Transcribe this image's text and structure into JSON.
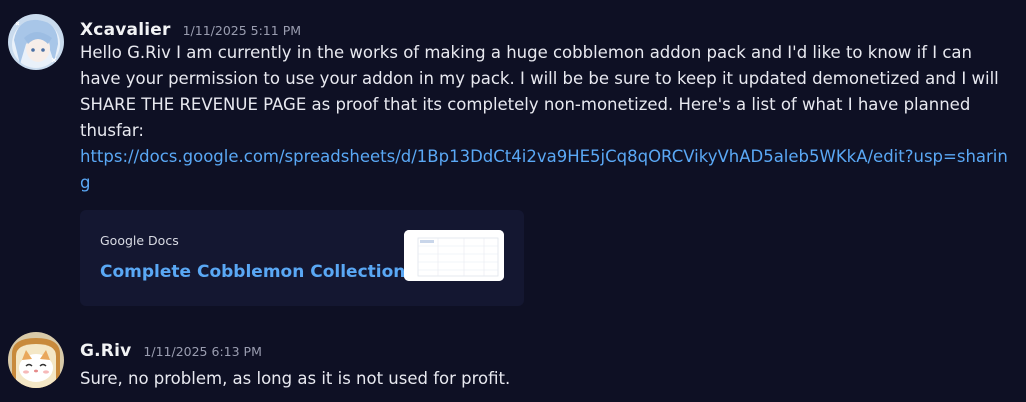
{
  "messages": [
    {
      "username": "Xcavalier",
      "timestamp": "1/11/2025 5:11 PM",
      "text": "Hello G.Riv I am currently in the works of making a huge cobblemon addon pack and I'd like to know if I can have your permission to use your addon in my pack. I will be be sure to keep it updated demonetized and I will SHARE THE REVENUE PAGE as proof that its completely non-monetized. Here's a list of what I have planned thusfar:",
      "link": "https://docs.google.com/spreadsheets/d/1Bp13DdCt4i2va9HE5jCq8qORCVikyVhAD5aleb5WKkA/edit?usp=sharing",
      "embed": {
        "provider": "Google Docs",
        "title": "Complete Cobblemon Collection"
      }
    },
    {
      "username": "G.Riv",
      "timestamp": "1/11/2025 6:13 PM",
      "text": "Sure, no problem, as long as it is not used for profit."
    }
  ],
  "colors": {
    "background": "#0e1024",
    "link": "#5aa8f5",
    "embed_background": "#141731",
    "timestamp": "#9a9db0"
  },
  "icons": {
    "avatar_1": "anime-girl-avatar",
    "avatar_2": "bread-cat-avatar",
    "embed_thumbnail": "spreadsheet-thumbnail"
  }
}
